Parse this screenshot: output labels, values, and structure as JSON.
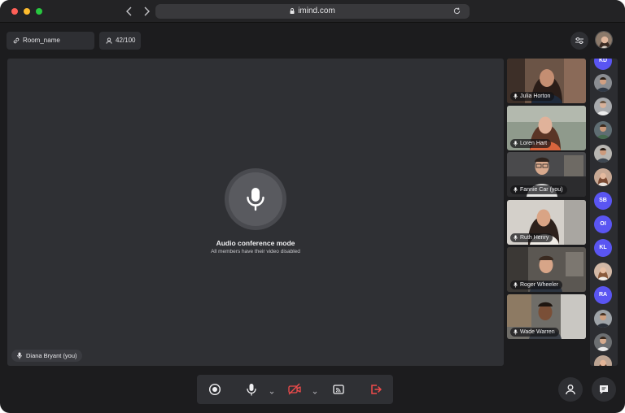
{
  "browser": {
    "url": "imind.com",
    "icons": [
      "back-icon",
      "forward-icon",
      "lock-icon",
      "reload-icon"
    ]
  },
  "topbar": {
    "room_name": "Room_name",
    "participant_count": "42/100"
  },
  "stage": {
    "mode_title": "Audio conference mode",
    "mode_subtitle": "All members have their video disabled",
    "speaker_name": "Diana Bryant (you)"
  },
  "participants": [
    {
      "name": "Julia Horton"
    },
    {
      "name": "Loren Hart"
    },
    {
      "name": "Fannie Car (you)"
    },
    {
      "name": "Ruth Henry"
    },
    {
      "name": "Roger Wheeler"
    },
    {
      "name": "Wade Warren"
    }
  ],
  "avatar_rail": [
    {
      "initials": "KD"
    },
    {
      "photo": true
    },
    {
      "photo": true
    },
    {
      "photo": true
    },
    {
      "photo": true
    },
    {
      "photo": true
    },
    {
      "initials": "SB"
    },
    {
      "initials": "OI"
    },
    {
      "initials": "KL"
    },
    {
      "photo": true
    },
    {
      "initials": "RA"
    },
    {
      "photo": true
    },
    {
      "photo": true
    },
    {
      "photo": true
    }
  ],
  "toolbar": {
    "buttons": [
      "record-button",
      "microphone-button",
      "camera-off-button",
      "share-screen-button",
      "leave-button"
    ]
  },
  "colors": {
    "background": "#1c1c1e",
    "panel": "#2f3034",
    "accent": "#5a55f2",
    "danger": "#ef4b4b"
  }
}
